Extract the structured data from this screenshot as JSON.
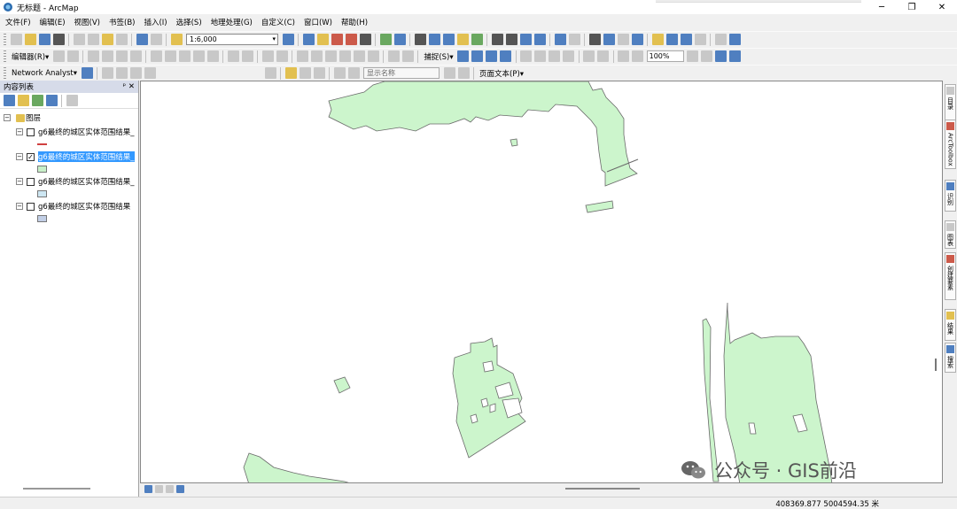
{
  "window": {
    "title": "无标题 - ArcMap",
    "min": "─",
    "restore": "❐",
    "close": "✕"
  },
  "menu": [
    "文件(F)",
    "编辑(E)",
    "视图(V)",
    "书签(B)",
    "插入(I)",
    "选择(S)",
    "地理处理(G)",
    "自定义(C)",
    "窗口(W)",
    "帮助(H)"
  ],
  "toolbar": {
    "scale": "1:6,000"
  },
  "editor_toolbar": {
    "editor_label": "编辑器(R)▾",
    "snapping_label": "捕捉(S)▾",
    "zoom_value": "100%"
  },
  "network_toolbar": {
    "network_label": "Network Analyst▾",
    "display_name_placeholder": "显示名称",
    "page_text_label": "页面文本(P)▾"
  },
  "toc": {
    "header": "内容列表",
    "pin": "ᵖ",
    "close": "✕",
    "root": "图层",
    "layers": [
      {
        "name": "g6最终的城区实体范围结果_",
        "checked": false,
        "symbol": "line",
        "color": "#d04040"
      },
      {
        "name": "g6最终的城区实体范围结果_",
        "checked": true,
        "selected": true,
        "symbol": "fill",
        "color": "#c8f0c8"
      },
      {
        "name": "g6最终的城区实体范围结果_",
        "checked": false,
        "symbol": "fill",
        "color": "#cde6f2"
      },
      {
        "name": "g6最终的城区实体范围结果",
        "checked": false,
        "symbol": "fill",
        "color": "#c2cfe6"
      }
    ]
  },
  "map": {
    "polygon_fill": "#ccf5cc",
    "polygon_stroke": "#6a6a6a"
  },
  "right_dock": [
    "目录",
    "ArcToolbox",
    "识别",
    "图表",
    "创建要素",
    "结果",
    "搜索"
  ],
  "status": {
    "coordinates": "408369.877  5004594.35 米"
  },
  "watermark": {
    "text": "公众号 · GIS前沿"
  }
}
